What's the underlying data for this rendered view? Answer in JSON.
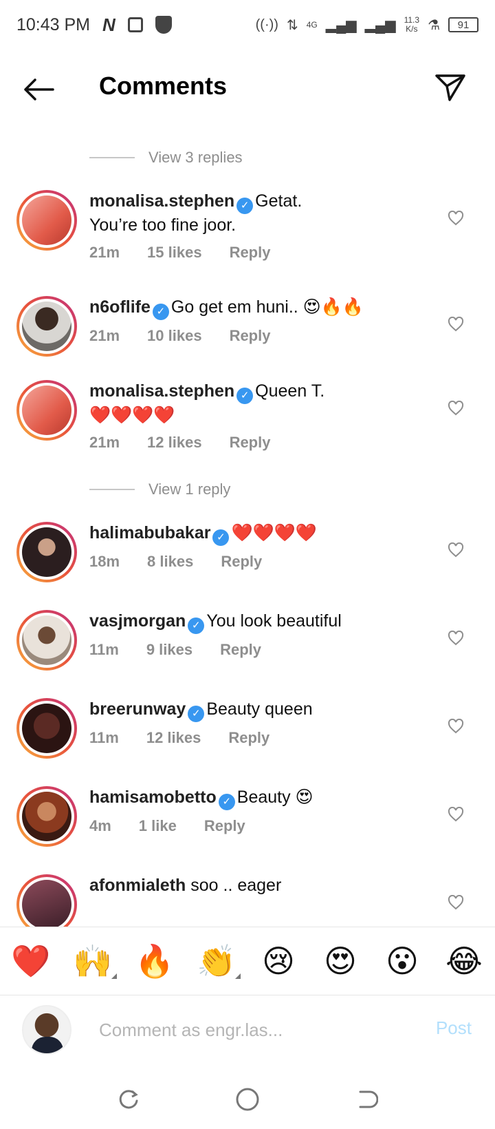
{
  "status_bar": {
    "time": "10:43 PM",
    "net_speed": "11.3\nK/s",
    "net_type": "4G",
    "battery": "91"
  },
  "header": {
    "title": "Comments"
  },
  "reply_threads": [
    {
      "label": "View 3 replies"
    },
    {
      "label": "View 1 reply"
    }
  ],
  "comments": [
    {
      "user": "monalisa.stephen",
      "verified": true,
      "text": "Getat.\nYou’re too fine joor.",
      "time": "21m",
      "likes": "15 likes",
      "reply": "Reply",
      "avatar_color": "#e96a5c"
    },
    {
      "user": "n6oflife",
      "verified": true,
      "text": "Go get em huni.. 😍🔥🔥",
      "time": "21m",
      "likes": "10 likes",
      "reply": "Reply",
      "avatar_color": "#6d6a66"
    },
    {
      "user": "monalisa.stephen",
      "verified": true,
      "text": "Queen T.\n❤️❤️❤️❤️",
      "time": "21m",
      "likes": "12 likes",
      "reply": "Reply",
      "avatar_color": "#e96a5c"
    },
    {
      "user": "halimabubakar",
      "verified": true,
      "text": "❤️❤️❤️❤️",
      "time": "18m",
      "likes": "8 likes",
      "reply": "Reply",
      "avatar_color": "#3b2b2d"
    },
    {
      "user": "vasjmorgan",
      "verified": true,
      "text": "You look beautiful",
      "time": "11m",
      "likes": "9 likes",
      "reply": "Reply",
      "avatar_color": "#c9b8a8"
    },
    {
      "user": "breerunway",
      "verified": true,
      "text": "Beauty queen",
      "time": "11m",
      "likes": "12 likes",
      "reply": "Reply",
      "avatar_color": "#4a2420"
    },
    {
      "user": "hamisamobetto",
      "verified": true,
      "text": "Beauty 😍",
      "time": "4m",
      "likes": "1 like",
      "reply": "Reply",
      "avatar_color": "#7a3a22"
    },
    {
      "user": "afonmialeth",
      "verified": false,
      "text": "soo .. eager",
      "time": "",
      "likes": "",
      "reply": "",
      "avatar_color": "#8c4a5a"
    }
  ],
  "emoji_bar": [
    "❤️",
    "🙌",
    "🔥",
    "👏",
    "😢",
    "😍",
    "😮",
    "😂"
  ],
  "input": {
    "placeholder": "Comment as engr.las...",
    "post_label": "Post"
  },
  "icons": {
    "back": "arrow-left-icon",
    "send": "paper-plane-icon",
    "heart": "heart-outline-icon",
    "verified": "verified-badge-icon"
  },
  "colors": {
    "verified_blue": "#3897f0",
    "meta_gray": "#8e8e8e",
    "post_disabled": "#b2dffc"
  }
}
